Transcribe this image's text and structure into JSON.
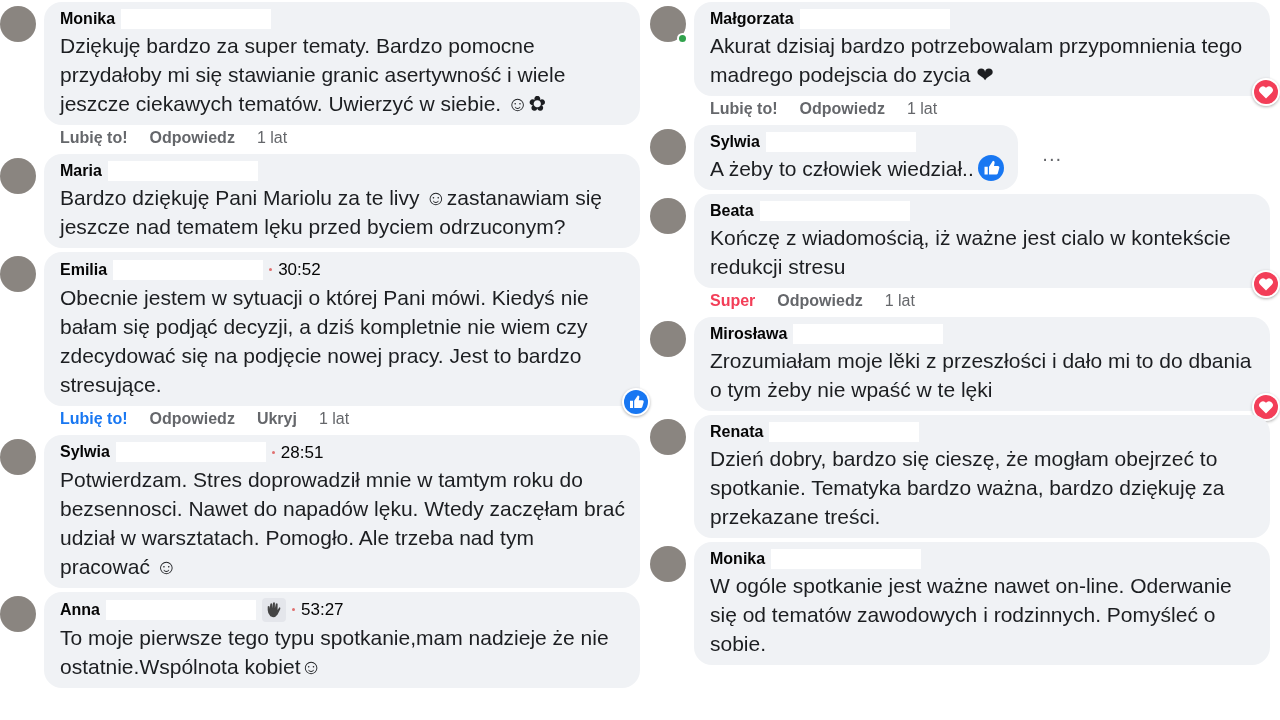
{
  "columns": [
    {
      "comments": [
        {
          "author": "Monika",
          "name_redacted": true,
          "body": [
            {
              "kind": "text",
              "text": "Dziękuję bardzo za super tematy. Bardzo pomocne przydałoby mi się stawianie granic asertywność i wiele jeszcze ciekawych tematów. Uwierzyć w siebie. ☺✿"
            }
          ],
          "actions": [
            {
              "kind": "reaction-none",
              "label": "Lubię to!"
            },
            {
              "kind": "link",
              "label": "Odpowiedz"
            },
            {
              "kind": "age",
              "label": "1 lat"
            }
          ]
        },
        {
          "author": "Maria",
          "name_redacted": true,
          "body": [
            {
              "kind": "text",
              "text": "Bardzo dziękuję Pani Mariolu za te livy ☺zastanawiam się jeszcze nad tematem lęku przed byciem odrzuconym?"
            }
          ]
        },
        {
          "author": "Emilia",
          "name_redacted": true,
          "time": "30:52",
          "body": [
            {
              "kind": "text",
              "text": "Obecnie jestem w sytuacji o której Pani mówi. Kiedyś nie bałam się podjąć decyzji, a dziś kompletnie nie wiem czy zdecydować się na podjęcie nowej pracy. Jest to bardzo stresujące."
            }
          ],
          "reaction_badge": {
            "kind": "like"
          },
          "actions": [
            {
              "kind": "reaction-like",
              "label": "Lubię to!"
            },
            {
              "kind": "link",
              "label": "Odpowiedz"
            },
            {
              "kind": "link",
              "label": "Ukryj"
            },
            {
              "kind": "age",
              "label": "1 lat"
            }
          ]
        },
        {
          "author": "Sylwia",
          "name_redacted": true,
          "time": "28:51",
          "body": [
            {
              "kind": "text",
              "text": "Potwierdzam. Stres doprowadził mnie w tamtym roku do bezsennosci. Nawet do napadów lęku. Wtedy zaczęłam brać udział w warsztatach. Pomogło. Ale trzeba nad tym pracować ☺"
            }
          ]
        },
        {
          "author": "Anna",
          "name_redacted": true,
          "hand_badge": true,
          "time": "53:27",
          "body": [
            {
              "kind": "text",
              "text": "To moje pierwsze tego typu spotkanie,mam nadzieje że nie ostatnie.Wspólnota kobiet☺"
            }
          ]
        }
      ]
    },
    {
      "comments": [
        {
          "author": "Małgorzata",
          "name_redacted": true,
          "online": true,
          "body": [
            {
              "kind": "text",
              "text": "Akurat dzisiaj bardzo potrzebowalam przypomnienia tego madrego podejscia do zycia ❤"
            }
          ],
          "reaction_badge": {
            "kind": "love"
          },
          "actions": [
            {
              "kind": "reaction-none",
              "label": "Lubię to!"
            },
            {
              "kind": "link",
              "label": "Odpowiedz"
            },
            {
              "kind": "age",
              "label": "1 lat"
            }
          ]
        },
        {
          "author": "Sylwia",
          "name_redacted": true,
          "more": "···",
          "body": [
            {
              "kind": "text",
              "text": "A żeby to człowiek wiedział.."
            },
            {
              "kind": "like"
            }
          ]
        },
        {
          "author": "Beata",
          "name_redacted": true,
          "body": [
            {
              "kind": "text",
              "text": "Kończę z wiadomością, iż ważne jest cialo w kontekście redukcji stresu"
            }
          ],
          "reaction_badge": {
            "kind": "love"
          },
          "actions": [
            {
              "kind": "reaction-love",
              "label": "Super"
            },
            {
              "kind": "link",
              "label": "Odpowiedz"
            },
            {
              "kind": "age",
              "label": "1 lat"
            }
          ]
        },
        {
          "author": "Mirosława",
          "name_redacted": true,
          "body": [
            {
              "kind": "text",
              "text": "Zrozumiałam moje lěki z przeszłości i dało mi to do dbania o tym żeby nie wpaść w te lęki"
            }
          ],
          "reaction_badge": {
            "kind": "love"
          }
        },
        {
          "author": "Renata",
          "name_redacted": true,
          "body": [
            {
              "kind": "text",
              "text": "Dzień dobry, bardzo się cieszę, że mogłam obejrzeć to spotkanie. Tematyka bardzo ważna, bardzo dziękuję za przekazane treści."
            }
          ]
        },
        {
          "author": "Monika",
          "name_redacted": true,
          "body": [
            {
              "kind": "text",
              "text": "W ogóle spotkanie jest ważne nawet on-line. Oderwanie się od tematów zawodowych i rodzinnych. Pomyśleć o sobie."
            }
          ]
        }
      ]
    }
  ]
}
